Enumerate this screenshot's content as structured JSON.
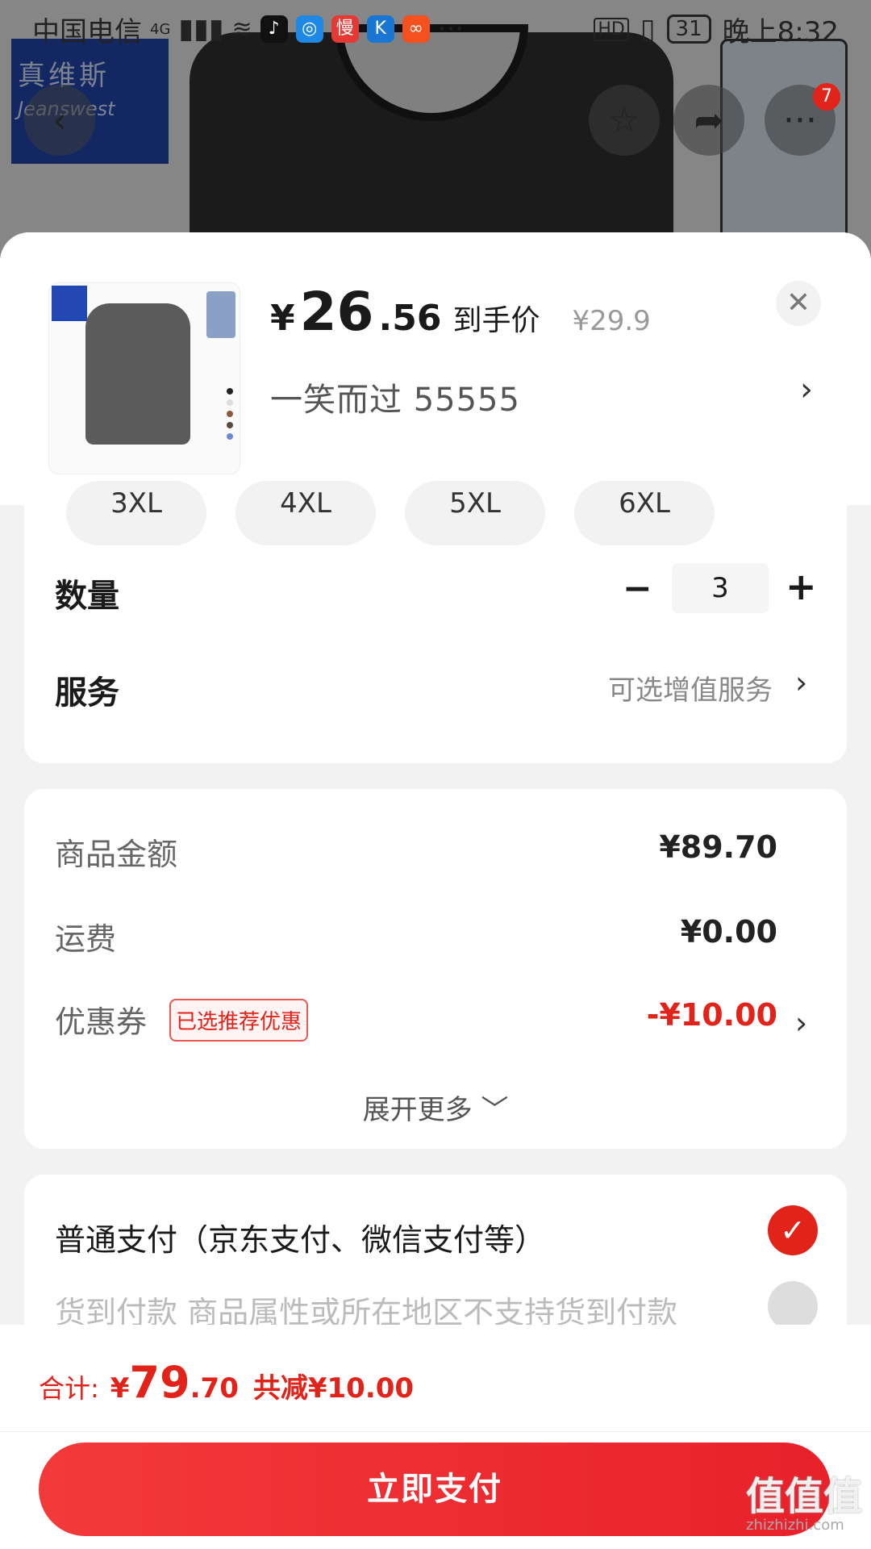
{
  "status_bar": {
    "carrier": "中国电信",
    "network": "4G",
    "more": "···",
    "hd": "HD",
    "battery": "31",
    "time": "晚上8:32",
    "apps": [
      "douyin",
      "browser",
      "manman",
      "kugou",
      "other"
    ]
  },
  "background": {
    "brand_zh": "真维斯",
    "brand_en": "Jeanswest",
    "cart_badge": "7"
  },
  "product": {
    "price_symbol": "¥",
    "price_int": "26",
    "price_dec": ".56",
    "price_label": "到手价",
    "original_price": "¥29.9",
    "variant": "一笑而过  55555"
  },
  "sizes": [
    "3XL",
    "4XL",
    "5XL",
    "6XL"
  ],
  "quantity": {
    "label": "数量",
    "value": "3",
    "minus": "−",
    "plus": "+"
  },
  "service": {
    "label": "服务",
    "value": "可选增值服务"
  },
  "summary": {
    "goods_label": "商品金额",
    "goods_value": "¥89.70",
    "shipping_label": "运费",
    "shipping_value": "¥0.00",
    "coupon_label": "优惠券",
    "coupon_tag": "已选推荐优惠",
    "coupon_value": "-¥10.00",
    "expand_label": "展开更多"
  },
  "payment": {
    "normal_label": "普通支付（京东支付、微信支付等）",
    "cod_label": "货到付款  商品属性或所在地区不支持货到付款"
  },
  "footer": {
    "total_label": "合计:",
    "total_symbol": "¥",
    "total_int": "79",
    "total_dec": ".70",
    "saved": "共减¥10.00",
    "pay_button": "立即支付"
  },
  "watermark": {
    "main": "值值值",
    "sub": "zhizhizhi.com"
  },
  "colors": {
    "accent": "#e2231a",
    "sheet_bg": "#f2f2f2"
  }
}
